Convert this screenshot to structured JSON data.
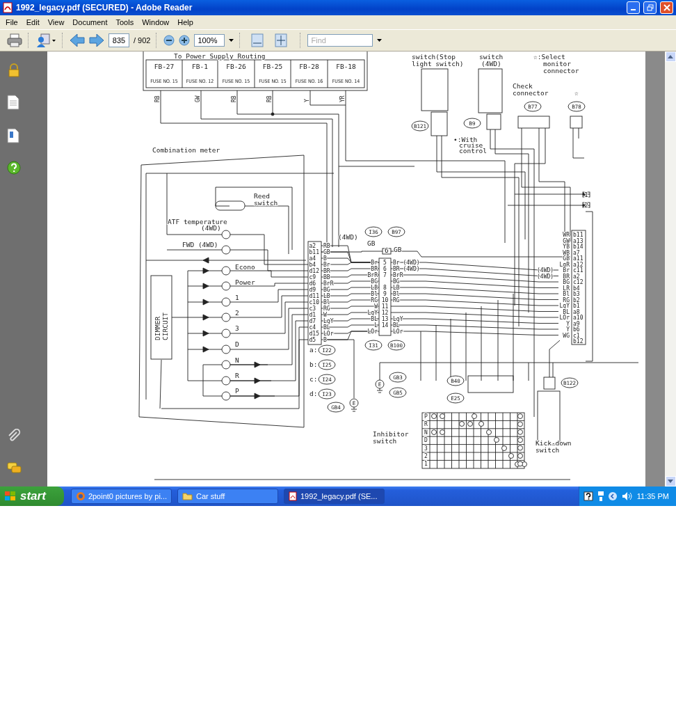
{
  "window": {
    "title": "1992_legacy.pdf (SECURED) - Adobe Reader"
  },
  "menu": [
    "File",
    "Edit",
    "View",
    "Document",
    "Tools",
    "Window",
    "Help"
  ],
  "toolbar": {
    "page_number": "835",
    "page_total": "/ 902",
    "zoom": "100%",
    "find_placeholder": "Find"
  },
  "diagram": {
    "header": "To Power Supply Routing",
    "fuses": [
      {
        "block": "FB-27",
        "fuse": "FUSE NO. 15"
      },
      {
        "block": "FB-1",
        "fuse": "FUSE NO. 12"
      },
      {
        "block": "FB-26",
        "fuse": "FUSE NO. 15"
      },
      {
        "block": "FB-25",
        "fuse": "FUSE NO. 15"
      },
      {
        "block": "FB-28",
        "fuse": "FUSE NO. 16"
      },
      {
        "block": "FB-18",
        "fuse": "FUSE NO. 14"
      }
    ],
    "fuse_wires": [
      "RB",
      "GW",
      "RB",
      "RB",
      "Y",
      "YR"
    ],
    "labels": [
      "switch(Stop",
      "light switch)",
      "switch",
      "(4WD)",
      "☆:Select",
      "monitor",
      "connector",
      "Check",
      "connector",
      "☆",
      "•:With",
      "cruise",
      "control",
      "Combination meter",
      "Reed",
      "switch",
      "ATF temperature",
      "(4WD)",
      "FWD (4WD)",
      "Econo",
      "Power",
      "1",
      "2",
      "3",
      "D",
      "N",
      "R",
      "P",
      "(4WD)",
      "GB",
      "GB",
      "6",
      "a:",
      "b:",
      "c:",
      "d:",
      "Inhibitor",
      "switch",
      "Kick-down",
      "switch",
      "1",
      "2"
    ],
    "dimmer_lines": [
      "DIMMER",
      "CIRCUIT"
    ],
    "connector_ids": [
      "B121",
      "B9",
      "B77",
      "B78",
      "I36",
      "B97",
      "I31",
      "B100",
      "I22",
      "I25",
      "I24",
      "I23",
      "GB4",
      "GB3",
      "GB5",
      "B40",
      "E25",
      "B122"
    ],
    "grounds": [
      "E",
      "E"
    ],
    "meter_pins": [
      "a2",
      "b11",
      "a4",
      "b4",
      "d12",
      "c9",
      "d6",
      "d9",
      "d11",
      "c10",
      "c3",
      "d1",
      "d7",
      "c4",
      "d15",
      "d5"
    ],
    "meter_wires": [
      "RB",
      "GB",
      "B",
      "Br",
      "BR",
      "BB",
      "BrR",
      "BG",
      "LB",
      "Bl",
      "RG",
      "W",
      "LgY",
      "BL",
      "LOr",
      "B"
    ],
    "junction_pins": [
      "5",
      "6",
      "7",
      "8",
      "9",
      "10",
      "11",
      "12",
      "13",
      "14"
    ],
    "junction_left_wires": [
      "Br",
      "BR",
      "BrR",
      "BG",
      "LB",
      "Bl",
      "RG",
      "W",
      "LgY",
      "BL",
      "L",
      "LOr"
    ],
    "junction_right_wires": [
      "Br (4WD)",
      "BR (4WD)",
      "BrR",
      "BG",
      "LB",
      "Bl",
      "RG",
      "LgY",
      "BL",
      "LOr"
    ],
    "ecu_pins": [
      "b11",
      "a13",
      "b14",
      "a7",
      "a11",
      "a12",
      "c11",
      "a2",
      "c12",
      "b4",
      "b3",
      "b2",
      "b1",
      "a8",
      "a10",
      "a9",
      "b6",
      "c1",
      "b12"
    ],
    "ecu_wires": [
      "WR",
      "GW",
      "YB",
      "WB",
      "GB",
      "LgR",
      "Br",
      "BR",
      "BG",
      "LR",
      "Bl",
      "RG",
      "LgY",
      "BL",
      "LOr",
      "Y",
      "Y",
      "WG"
    ],
    "ecu_notes": [
      "(4WD)",
      "(4WD)"
    ],
    "inhibitor_positions": [
      "P",
      "R",
      "N",
      "D",
      "3",
      "2",
      "1"
    ]
  },
  "taskbar": {
    "start": "start",
    "tasks": [
      {
        "label": "2point0 pictures by pi...",
        "selected": false
      },
      {
        "label": "Car stuff",
        "selected": false
      },
      {
        "label": "1992_legacy.pdf (SE...",
        "selected": true
      }
    ],
    "clock": "11:35 PM"
  }
}
